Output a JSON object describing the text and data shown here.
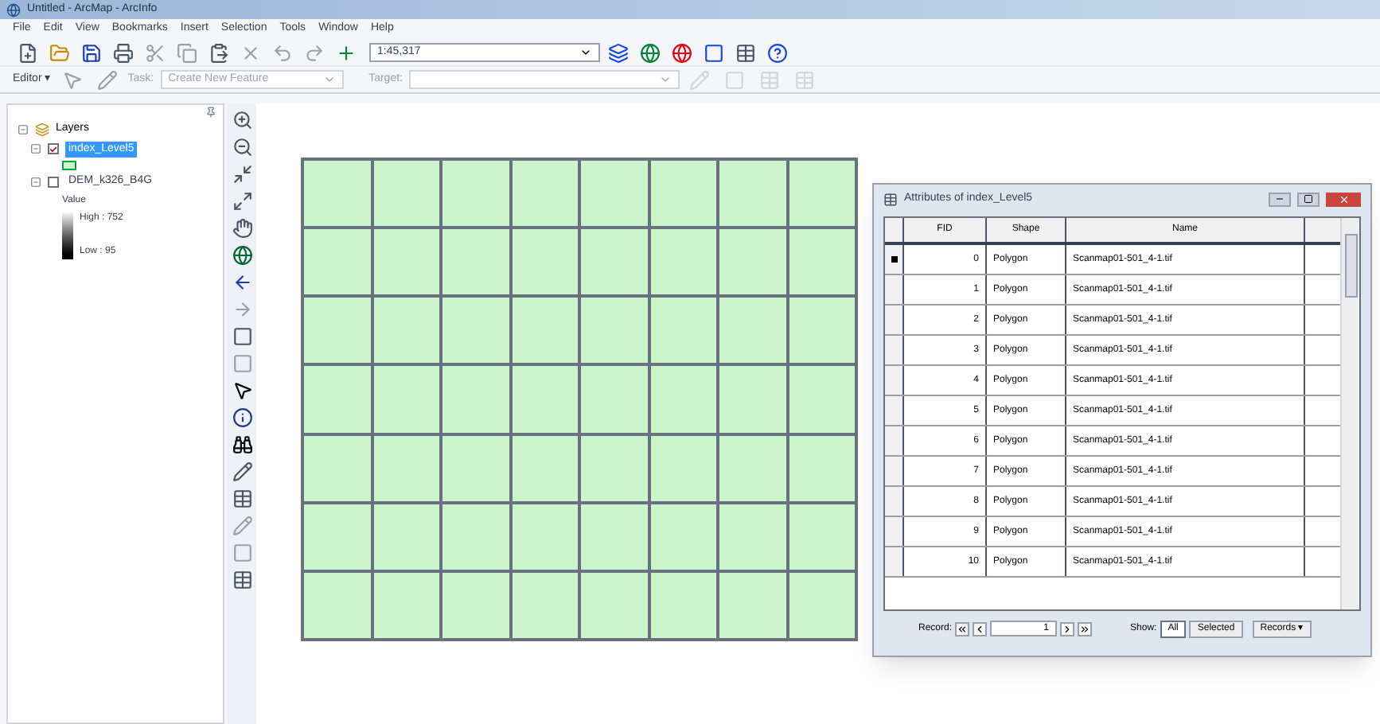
{
  "window": {
    "title": "Untitled - ArcMap - ArcInfo"
  },
  "menu": [
    "File",
    "Edit",
    "View",
    "Bookmarks",
    "Insert",
    "Selection",
    "Tools",
    "Window",
    "Help"
  ],
  "standard_toolbar": {
    "scale": "1:45,317"
  },
  "editor_toolbar": {
    "editor": "Editor ▾",
    "task_label": "Task:",
    "task": "Create New Feature",
    "target_label": "Target:"
  },
  "toc": {
    "root": "Layers",
    "layers": [
      {
        "name": "index_Level5",
        "checked": true,
        "selected": true
      },
      {
        "name": "DEM_k326_B4G",
        "checked": false,
        "selected": false,
        "legend": {
          "title": "Value",
          "high": "High : 752",
          "low": "Low : 95"
        }
      }
    ]
  },
  "map": {
    "kind": "polygon-grid"
  },
  "attributes": {
    "title": "Attributes of index_Level5",
    "columns": [
      "FID",
      "Shape",
      "Name"
    ],
    "rows": [
      {
        "fid": "0",
        "shape": "Polygon",
        "name": "Scanmap01-501_4-1.tif",
        "selected": true
      },
      {
        "fid": "1",
        "shape": "Polygon",
        "name": "Scanmap01-501_4-1.tif",
        "selected": false
      },
      {
        "fid": "2",
        "shape": "Polygon",
        "name": "Scanmap01-501_4-1.tif",
        "selected": false
      },
      {
        "fid": "3",
        "shape": "Polygon",
        "name": "Scanmap01-501_4-1.tif",
        "selected": false
      },
      {
        "fid": "4",
        "shape": "Polygon",
        "name": "Scanmap01-501_4-1.tif",
        "selected": false
      },
      {
        "fid": "5",
        "shape": "Polygon",
        "name": "Scanmap01-501_4-1.tif",
        "selected": false
      },
      {
        "fid": "6",
        "shape": "Polygon",
        "name": "Scanmap01-501_4-1.tif",
        "selected": false
      },
      {
        "fid": "7",
        "shape": "Polygon",
        "name": "Scanmap01-501_4-1.tif",
        "selected": false
      },
      {
        "fid": "8",
        "shape": "Polygon",
        "name": "Scanmap01-501_4-1.tif",
        "selected": false
      },
      {
        "fid": "9",
        "shape": "Polygon",
        "name": "Scanmap01-501_4-1.tif",
        "selected": false
      },
      {
        "fid": "10",
        "shape": "Polygon",
        "name": "Scanmap01-501_4-1.tif",
        "selected": false
      }
    ],
    "footer": {
      "record_label": "Record:",
      "record": "1",
      "show_label": "Show:",
      "all": "All",
      "selected": "Selected",
      "records": "Records ▾"
    }
  }
}
